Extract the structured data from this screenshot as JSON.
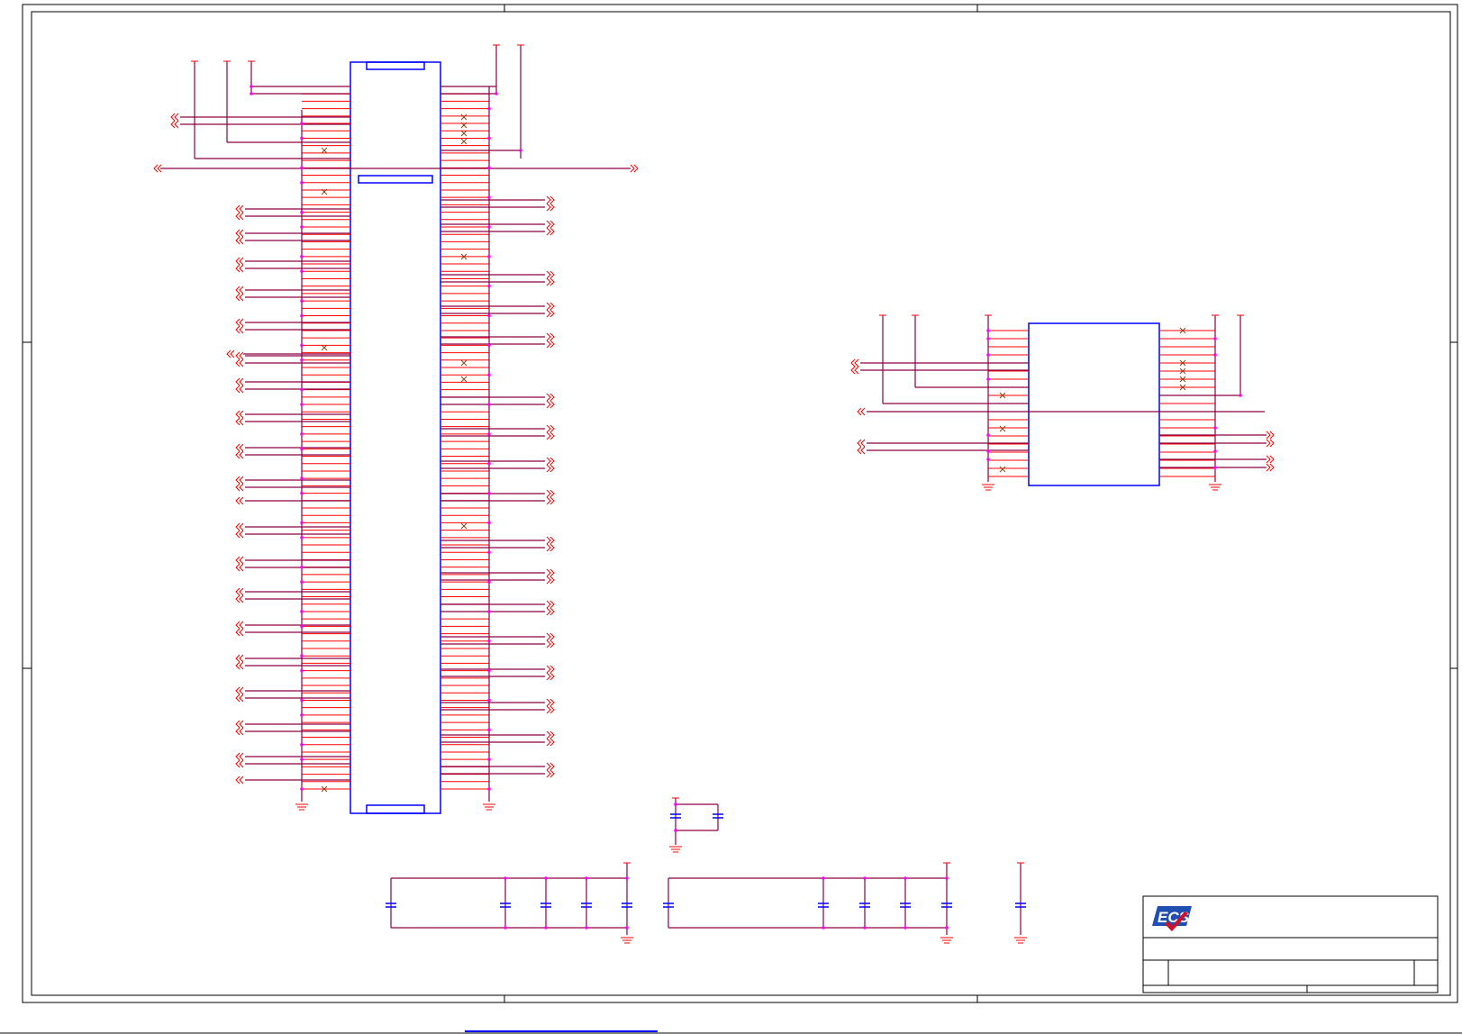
{
  "document": {
    "type": "schematic-sheet",
    "logo": {
      "text": "ECS",
      "colors": {
        "primary": "#1f4fb0",
        "check": "#d0102a"
      }
    },
    "title_block": {
      "title": "",
      "rev": ""
    },
    "bottom_link": {
      "text": ""
    }
  },
  "colors": {
    "border": "#000000",
    "body_outline": "#0000ff",
    "pin": "#ff0000",
    "wire": "#8b0045",
    "junction": "#ff00ff",
    "no_connect": "#8b4513",
    "capacitor": "#0000ff"
  },
  "connectors": {
    "main": {
      "rows": 96,
      "has_key_notches": true
    },
    "secondary": {
      "rows": 19
    }
  },
  "icons": [
    "ground-symbol-icon",
    "power-rail-icon",
    "offpage-connector-icon",
    "no-connect-icon",
    "capacitor-icon",
    "junction-dot-icon"
  ]
}
